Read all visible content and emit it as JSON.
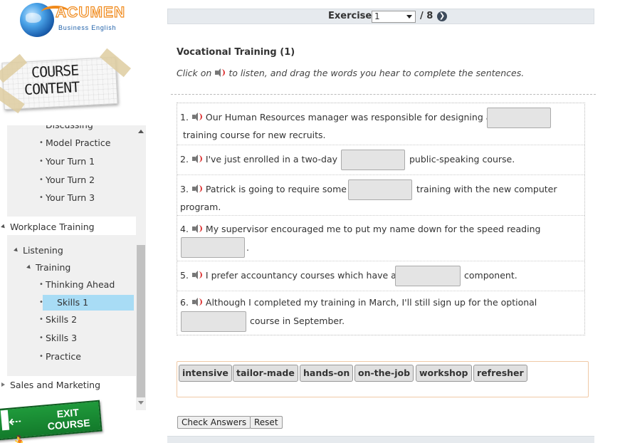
{
  "logo": {
    "brand": "ACUMEN",
    "subtitle": "Business English"
  },
  "course_content": {
    "line1": "COURSE",
    "line2": "CONTENT"
  },
  "tree": {
    "partial_item": "Discussing",
    "items_a": [
      "Model Practice",
      "Your Turn 1",
      "Your Turn 2",
      "Your Turn 3"
    ],
    "section": "Workplace Training",
    "listening": "Listening",
    "training": "Training",
    "items_b": [
      "Thinking Ahead",
      "Skills 1",
      "Skills 2",
      "Skills 3",
      "Practice"
    ],
    "selected_item": "Skills 1",
    "next_section": "Sales and Marketing"
  },
  "exit": {
    "line1": "EXIT",
    "line2": "COURSE"
  },
  "toolbar": {
    "exercise_label": "Exercise",
    "exercise_value": "1",
    "of_total": "/ 8"
  },
  "exercise": {
    "title": "Vocational Training (1)",
    "instruction_pre": "Click on",
    "instruction_post": "to listen, and drag the words you hear to complete the sentences."
  },
  "questions": [
    {
      "num": "1.",
      "before": "Our Human Resources manager was responsible for designing a",
      "after": "training course for new recruits."
    },
    {
      "num": "2.",
      "before": "I've just enrolled in a two-day",
      "after": "public-speaking course."
    },
    {
      "num": "3.",
      "before": "Patrick is going to require some",
      "after": "training with the new computer",
      "after2": "program."
    },
    {
      "num": "4.",
      "before": "My supervisor encouraged me to put my name down for the speed reading",
      "after": "."
    },
    {
      "num": "5.",
      "before": "I prefer accountancy courses which have a",
      "after": "component."
    },
    {
      "num": "6.",
      "before": "Although I completed my training in March, I'll still sign up for the optional",
      "after": "course in September."
    }
  ],
  "word_bank": [
    "intensive",
    "tailor-made",
    "hands-on",
    "on-the-job",
    "workshop",
    "refresher"
  ],
  "buttons": {
    "check": "Check Answers",
    "reset": "Reset"
  },
  "colors": {
    "selected": "#a8dcf5",
    "toolbar": "#e6eaee",
    "exit_green": "#1f9a3b",
    "word_bank_border": "#f0c9a6"
  }
}
